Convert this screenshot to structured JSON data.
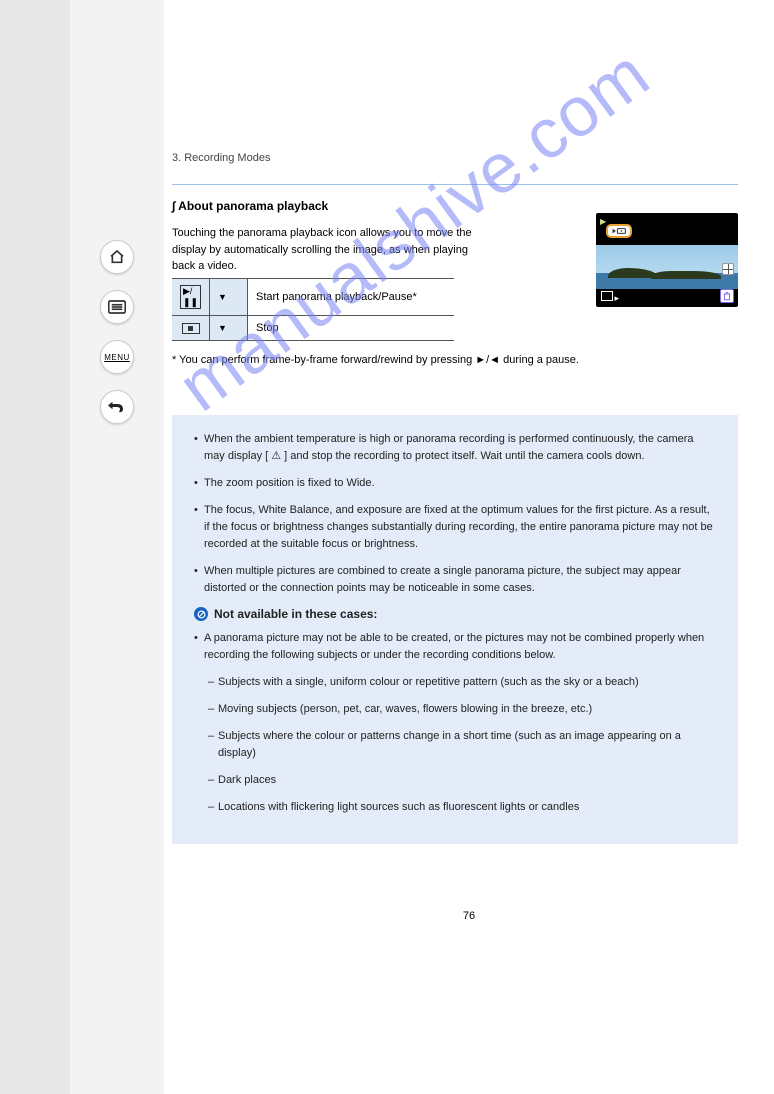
{
  "sidebar": {
    "home": "home-icon",
    "toc": "list-icon",
    "menu_label": "MENU",
    "back": "back-icon"
  },
  "breadcrumb": "3. Recording Modes",
  "section_title": "∫ About panorama playback",
  "section_body": "Touching the panorama playback icon allows you to move the display by automatically scrolling the image, as when playing back a video.",
  "table": {
    "rows": [
      {
        "icon": "play-pause-icon",
        "key_down": "▼",
        "label": "Start panorama playback/Pause*"
      },
      {
        "icon": "stop-icon",
        "key_down": "▼",
        "label": "Stop"
      }
    ],
    "footnote": "* You can perform frame-by-frame forward/rewind by pressing ►/◄ during a pause."
  },
  "info": {
    "bullets": [
      "When the ambient temperature is high or panorama recording is performed continuously, the camera may display [ ⚠ ] and stop the recording to protect itself. Wait until the camera cools down.",
      "The zoom position is fixed to Wide.",
      "The focus, White Balance, and exposure are fixed at the optimum values for the first picture. As a result, if the focus or brightness changes substantially during recording, the entire panorama picture may not be recorded at the suitable focus or brightness.",
      "When multiple pictures are combined to create a single panorama picture, the subject may appear distorted or the connection points may be noticeable in some cases."
    ],
    "not_available_label": "Not available in these cases:",
    "na_intro": "A panorama picture may not be able to be created, or the pictures may not be combined properly when recording the following subjects or under the recording conditions below.",
    "na_sub": [
      "Subjects with a single, uniform colour or repetitive pattern (such as the sky or a beach)",
      "Moving subjects (person, pet, car, waves, flowers blowing in the breeze, etc.)",
      "Subjects where the colour or patterns change in a short time (such as an image appearing on a display)",
      "Dark places",
      "Locations with flickering light sources such as fluorescent lights or candles"
    ]
  },
  "watermark": "manualshive.com",
  "page_number": "76"
}
